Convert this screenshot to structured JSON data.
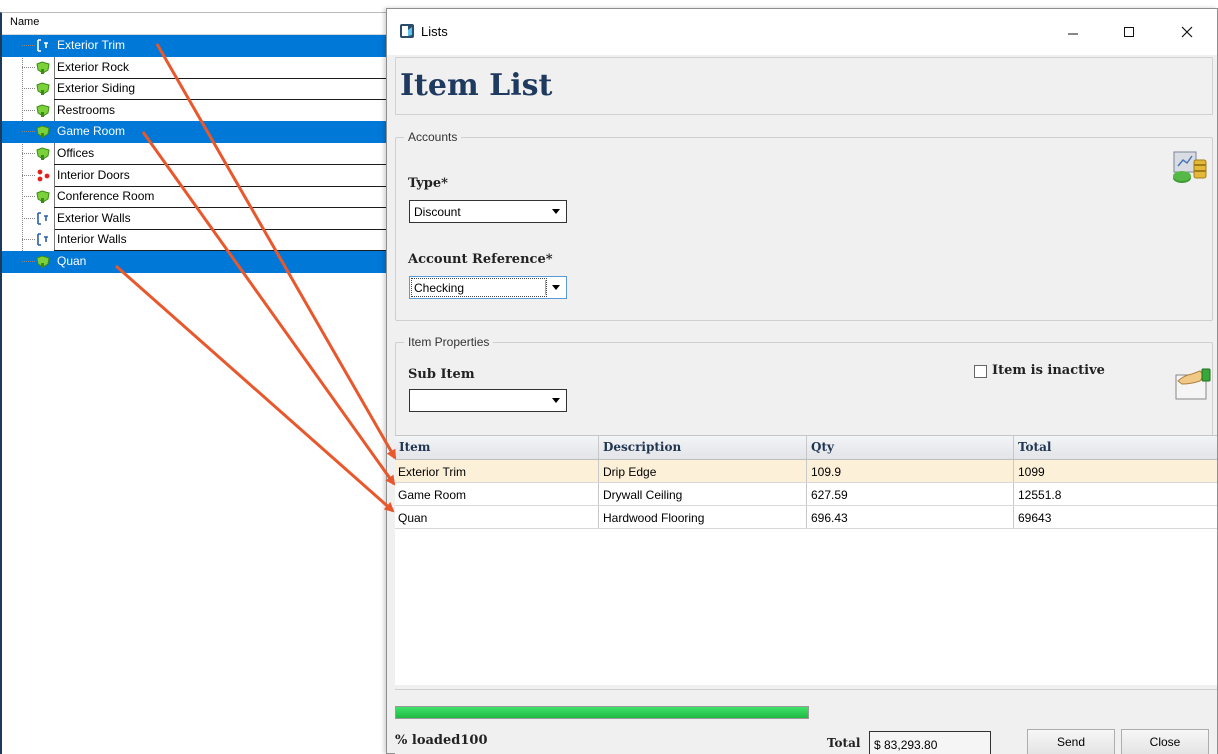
{
  "tree": {
    "header": "Name",
    "items": [
      {
        "label": "Exterior Trim",
        "icon": "measure-icon",
        "selected": true
      },
      {
        "label": "Exterior Rock",
        "icon": "green-area-icon",
        "selected": false
      },
      {
        "label": "Exterior Siding",
        "icon": "green-area-icon",
        "selected": false
      },
      {
        "label": "Restrooms",
        "icon": "green-area-icon",
        "selected": false
      },
      {
        "label": "Game Room",
        "icon": "green-area-icon",
        "selected": true
      },
      {
        "label": "Offices",
        "icon": "green-area-icon",
        "selected": false
      },
      {
        "label": "Interior Doors",
        "icon": "count-dots-icon",
        "selected": false
      },
      {
        "label": "Conference Room",
        "icon": "green-area-icon",
        "selected": false
      },
      {
        "label": "Exterior Walls",
        "icon": "measure-icon",
        "selected": false
      },
      {
        "label": "Interior Walls",
        "icon": "measure-icon",
        "selected": false
      },
      {
        "label": "Quan",
        "icon": "green-area-icon",
        "selected": true
      }
    ]
  },
  "dialog": {
    "title": "Lists",
    "heading": "Item List",
    "accounts": {
      "legend": "Accounts",
      "type_label": "Type*",
      "type_value": "Discount",
      "account_ref_label": "Account Reference*",
      "account_ref_value": "Checking"
    },
    "item_props": {
      "legend": "Item Properties",
      "sub_item_label": "Sub Item",
      "sub_item_value": "",
      "inactive_label": "Item is inactive",
      "inactive_checked": false
    },
    "grid": {
      "columns": [
        "Item",
        "Description",
        "Qty",
        "Total"
      ],
      "rows": [
        [
          "Exterior Trim",
          "Drip Edge",
          "109.9",
          "1099"
        ],
        [
          "Game Room",
          "Drywall Ceiling",
          "627.59",
          "12551.8"
        ],
        [
          "Quan",
          "Hardwood Flooring",
          "696.43",
          "69643"
        ]
      ]
    },
    "footer": {
      "progress_percent": 100,
      "loaded_text": "% loaded100",
      "total_label": "Total",
      "total_value": "$ 83,293.80",
      "send_label": "Send",
      "close_label": "Close"
    }
  },
  "colors": {
    "selection": "#0078d7",
    "heading": "#1f3a5f",
    "arrow": "#e8582c",
    "progress": "#2ecc55",
    "current_row": "#fdf0d9"
  }
}
